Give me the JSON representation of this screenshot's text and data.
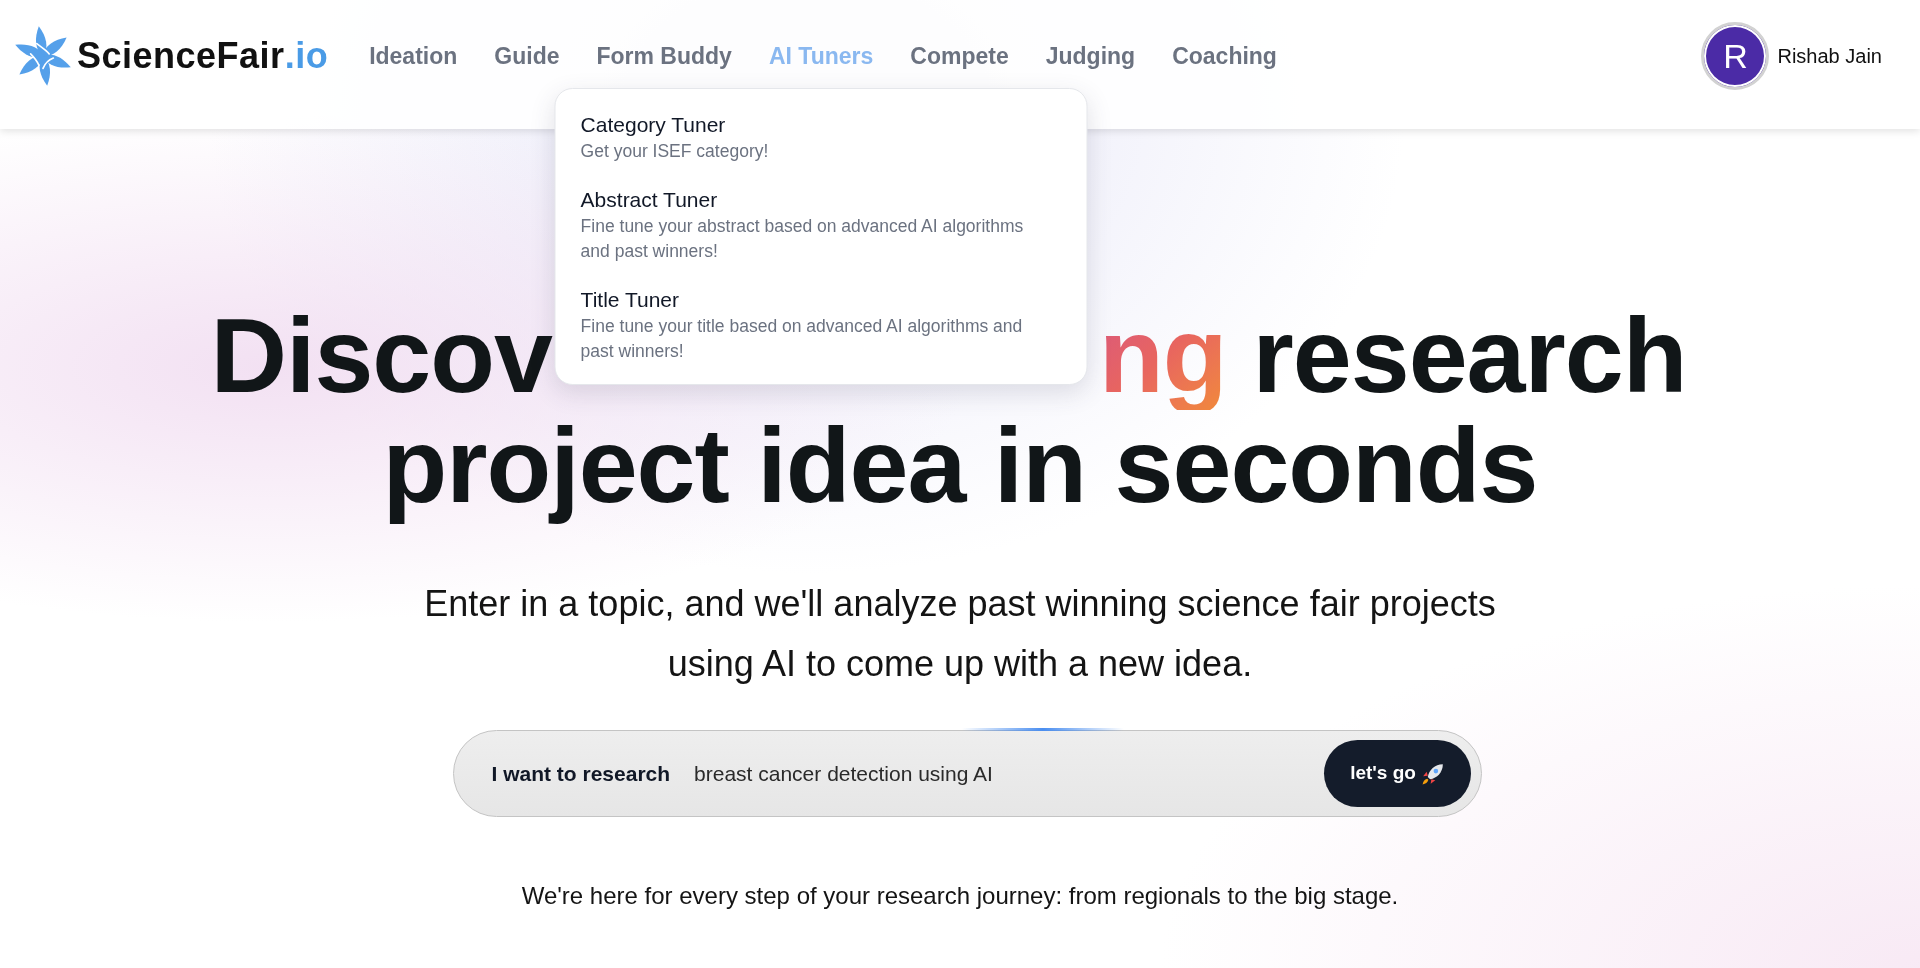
{
  "nav": {
    "logo": {
      "name": "ScienceFair",
      "suffix": ".io"
    },
    "items": [
      {
        "label": "Ideation",
        "selected": false
      },
      {
        "label": "Guide",
        "selected": false
      },
      {
        "label": "Form Buddy",
        "selected": false
      },
      {
        "label": "AI Tuners",
        "selected": true,
        "menu": [
          {
            "title": "Category Tuner",
            "description": "Get your ISEF category!"
          },
          {
            "title": "Abstract Tuner",
            "description": "Fine tune your abstract based on advanced AI algorithms and past winners!"
          },
          {
            "title": "Title Tuner",
            "description": "Fine tune your title based on advanced AI algorithms and past winners!"
          }
        ]
      },
      {
        "label": "Compete",
        "selected": false
      },
      {
        "label": "Judging",
        "selected": false
      },
      {
        "label": "Coaching",
        "selected": false
      }
    ],
    "user": {
      "initial": "R",
      "name": "Rishab Jain"
    }
  },
  "headline": {
    "line_1": [
      {
        "text": "Discov",
        "kind": "plain"
      },
      {
        "text": "ng",
        "kind": "gradient"
      },
      {
        "text": "research",
        "kind": "plain"
      }
    ],
    "line_2": "project idea in seconds"
  },
  "subtitle": "Enter in a topic, and we'll analyze past winning science fair projects using AI to come up with a new idea.",
  "search": {
    "label": "I want to research",
    "value": "breast cancer detection using AI",
    "button": "let's go"
  },
  "tagline": "We're here for every step of your research journey: from regionals to the big stage."
}
